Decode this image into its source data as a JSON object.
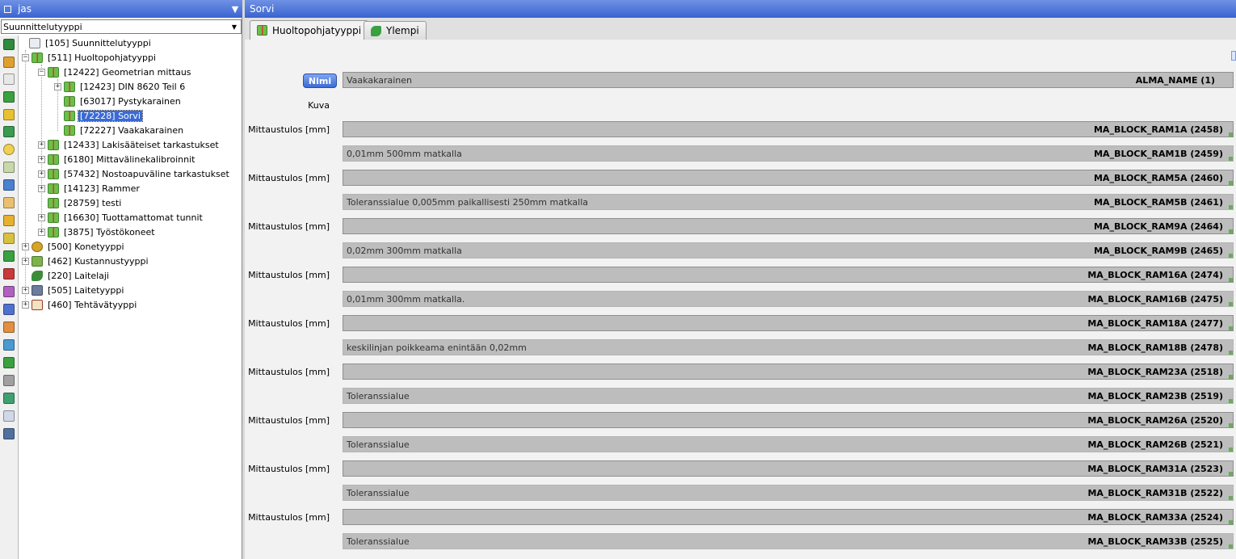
{
  "left_panel": {
    "title": "jas",
    "filter_icon": "funnel-icon",
    "type_select": {
      "value": "Suunnittelutyyppi"
    }
  },
  "tree": {
    "root": "[105]  Suunnittelutyyppi",
    "huolto": "[511]  Huoltopohjatyyppi",
    "geom": "[12422]  Geometrian mittaus",
    "din": "[12423]  DIN 8620 Teil 6",
    "pysty": "[63017]  Pystykarainen",
    "sorvi": "[72228]  Sorvi",
    "vaaka": "[72227]  Vaakakarainen",
    "laki": "[12433]  Lakisääteiset tarkastukset",
    "mitta": "[6180]  Mittavälinekalibroinnit",
    "nosto": "[57432]  Nostoapuväline tarkastukset",
    "rammer": "[14123]  Rammer",
    "testi": "[28759]  testi",
    "tuott": "[16630]  Tuottamattomat tunnit",
    "tyost": "[3875]  Työstökoneet",
    "kone": "[500]  Konetyyppi",
    "kust": "[462]  Kustannustyyppi",
    "laitelaji": "[220]  Laitelaji",
    "laitetyyppi": "[505]  Laitetyyppi",
    "tehtava": "[460]  Tehtävätyyppi"
  },
  "right_panel": {
    "title": "Sorvi",
    "tabs": {
      "huolto": "Huoltopohjatyyppi",
      "ylempi": "Ylempi"
    }
  },
  "form": {
    "name_button": "Nimi",
    "name_value": "Vaakakarainen",
    "name_code": "ALMA_NAME  (1)",
    "image_label": "Kuva",
    "measure_label": "Mittaustulos [mm]",
    "rows": [
      {
        "text": "",
        "code": "MA_BLOCK_RAM1A  (2458)"
      },
      {
        "text": "0,01mm 500mm matkalla",
        "code": "MA_BLOCK_RAM1B  (2459)"
      },
      {
        "text": "",
        "code": "MA_BLOCK_RAM5A  (2460)"
      },
      {
        "text": "Toleranssialue 0,005mm paikallisesti 250mm matkalla",
        "code": "MA_BLOCK_RAM5B  (2461)"
      },
      {
        "text": "",
        "code": "MA_BLOCK_RAM9A  (2464)"
      },
      {
        "text": "0,02mm 300mm matkalla",
        "code": "MA_BLOCK_RAM9B  (2465)"
      },
      {
        "text": "",
        "code": "MA_BLOCK_RAM16A  (2474)"
      },
      {
        "text": "0,01mm 300mm matkalla.",
        "code": "MA_BLOCK_RAM16B  (2475)"
      },
      {
        "text": "",
        "code": "MA_BLOCK_RAM18A  (2477)"
      },
      {
        "text": "keskilinjan poikkeama enintään 0,02mm",
        "code": "MA_BLOCK_RAM18B  (2478)"
      },
      {
        "text": "",
        "code": "MA_BLOCK_RAM23A  (2518)"
      },
      {
        "text": "Toleranssialue",
        "code": "MA_BLOCK_RAM23B  (2519)"
      },
      {
        "text": "",
        "code": "MA_BLOCK_RAM26A  (2520)"
      },
      {
        "text": "Toleranssialue",
        "code": "MA_BLOCK_RAM26B  (2521)"
      },
      {
        "text": "",
        "code": "MA_BLOCK_RAM31A  (2523)"
      },
      {
        "text": "Toleranssialue",
        "code": "MA_BLOCK_RAM31B  (2522)"
      },
      {
        "text": "",
        "code": "MA_BLOCK_RAM33A  (2524)"
      },
      {
        "text": "Toleranssialue",
        "code": "MA_BLOCK_RAM33B  (2525)"
      }
    ]
  },
  "colors": {
    "titlebar": "#3a63cf",
    "selection": "#3a6ad4",
    "field_bar": "#bdbdbd"
  }
}
